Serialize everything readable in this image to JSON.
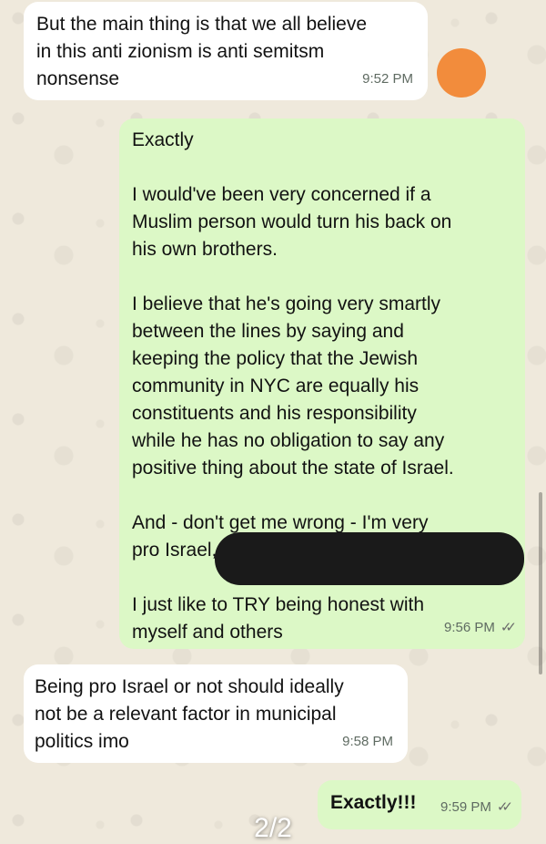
{
  "messages": [
    {
      "direction": "incoming",
      "text": "But the main thing is that we all believe\nin this anti zionism is anti semitsm\nnonsense",
      "time": "9:52 PM"
    },
    {
      "direction": "outgoing",
      "text": "Exactly\n\nI would've been very concerned if a\nMuslim person would turn his back on\nhis own brothers.\n\nI believe that he's going very smartly\nbetween the lines by saying and\nkeeping the policy that the Jewish\ncommunity in NYC are equally his\nconstituents and his responsibility\nwhile he has no obligation to say any\npositive thing about the state of Israel.\n\nAnd - don't get me wrong - I'm very\npro Israel,\n\nI just like to TRY being honest with\nmyself and others",
      "time": "9:56 PM",
      "status": "read"
    },
    {
      "direction": "incoming",
      "text": "Being pro Israel or not should ideally\nnot be a relevant factor in municipal\npolitics imo",
      "time": "9:58 PM"
    },
    {
      "direction": "outgoing",
      "text": "Exactly!!!",
      "time": "9:59 PM",
      "status": "read"
    }
  ],
  "ticks_glyph": "✓✓",
  "page_indicator": "2/2",
  "colors": {
    "incoming_bubble": "#ffffff",
    "outgoing_bubble": "#dcf8c6",
    "wallpaper": "#efe9dc",
    "avatar_dot": "#f28c3c"
  }
}
